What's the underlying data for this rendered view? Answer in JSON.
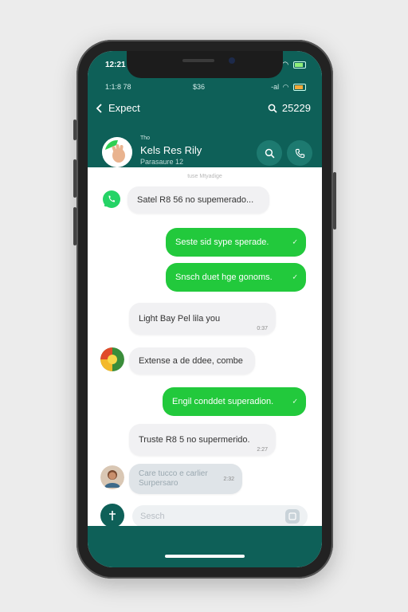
{
  "status": {
    "time": "12:21",
    "secondary_left": "1:1:8 78",
    "secondary_center": "$36",
    "secondary_right": "-al"
  },
  "nav": {
    "back_label": "Expect",
    "search_value": "25229"
  },
  "contact": {
    "small_label": "Tho",
    "name": "Kels Res Rily",
    "subtitle": "Parasaure 12"
  },
  "day_separator": "tuse  Mtyadige",
  "messages": [
    {
      "id": "m1",
      "dir": "in",
      "text": "Satel R8 56 no supemerado..."
    },
    {
      "id": "m2",
      "dir": "out",
      "text": "Seste sid sype sperade."
    },
    {
      "id": "m3",
      "dir": "out",
      "text": "Snsch duet hge gonoms."
    },
    {
      "id": "m4",
      "dir": "in",
      "text": "Light Bay Pel lila you",
      "time": "0:37"
    },
    {
      "id": "m5",
      "dir": "in",
      "text": "Extense a de ddee, combe"
    },
    {
      "id": "m6",
      "dir": "out",
      "text": "Engil conddet superadion."
    },
    {
      "id": "m7",
      "dir": "in",
      "text": "Truste R8 5 no supermerido.",
      "time": "2:27"
    },
    {
      "id": "m8",
      "dir": "in",
      "text": "Care tucco e carlier Surpersaro",
      "time": "2:32"
    }
  ],
  "input": {
    "placeholder": "Sesch"
  },
  "colors": {
    "header": "#0e6058",
    "outgoing": "#22c93c",
    "incoming": "#f1f1f3"
  }
}
